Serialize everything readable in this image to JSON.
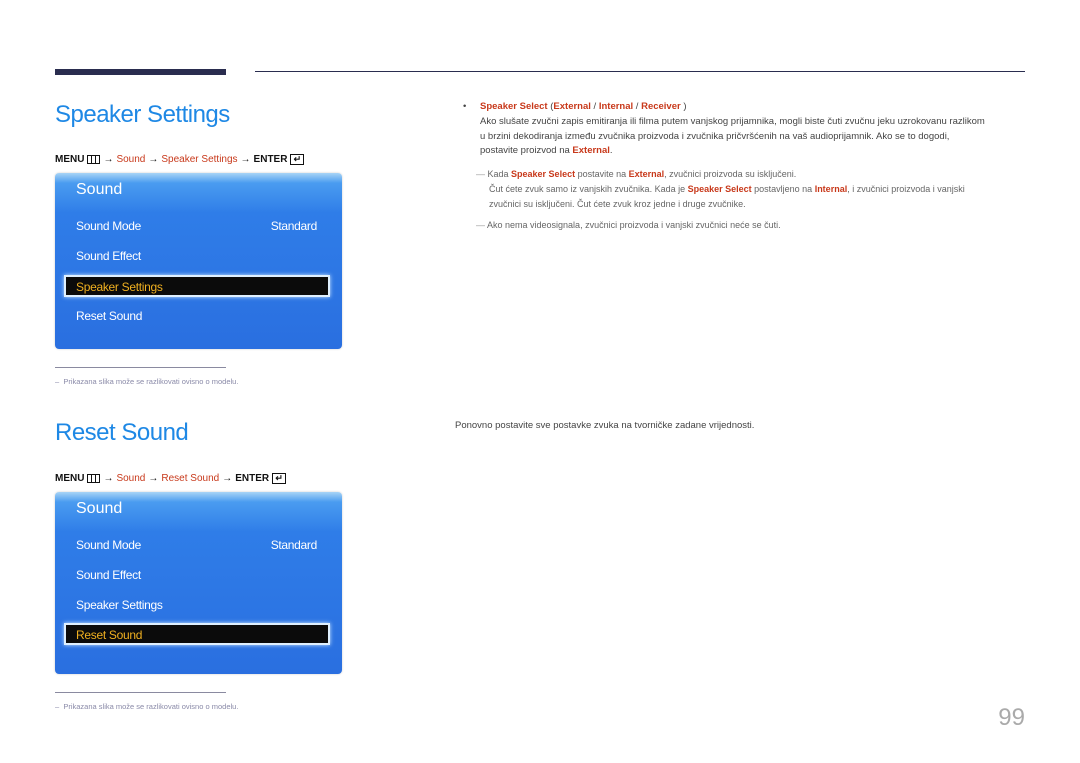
{
  "page_number": "99",
  "sections": [
    {
      "title": "Speaker Settings",
      "menu_path": {
        "menu": "MENU",
        "arrow": "→",
        "steps": [
          "Sound",
          "Speaker Settings"
        ],
        "enter": "ENTER",
        "enter_glyph": "↵"
      },
      "osd": {
        "title": "Sound",
        "items": [
          {
            "label": "Sound Mode",
            "value": "Standard"
          },
          {
            "label": "Sound Effect",
            "value": ""
          },
          {
            "label": "Speaker Settings",
            "value": "",
            "selected": true
          },
          {
            "label": "Reset Sound",
            "value": ""
          }
        ]
      },
      "footnote": "Prikazana slika može se razlikovati ovisno o modelu."
    },
    {
      "title": "Reset Sound",
      "menu_path": {
        "menu": "MENU",
        "arrow": "→",
        "steps": [
          "Sound",
          "Reset Sound"
        ],
        "enter": "ENTER",
        "enter_glyph": "↵"
      },
      "osd": {
        "title": "Sound",
        "items": [
          {
            "label": "Sound Mode",
            "value": "Standard"
          },
          {
            "label": "Sound Effect",
            "value": ""
          },
          {
            "label": "Speaker Settings",
            "value": ""
          },
          {
            "label": "Reset Sound",
            "value": "",
            "selected": true
          }
        ]
      },
      "footnote": "Prikazana slika može se razlikovati ovisno o modelu.",
      "description": "Ponovno postavite sve postavke zvuka na tvorničke zadane vrijednosti."
    }
  ],
  "speaker_select": {
    "bullet": "•",
    "name": "Speaker Select",
    "options_open": " (",
    "options": [
      "External",
      "Internal",
      "Receiver"
    ],
    "sep": " / ",
    "options_close": " )",
    "para_1": "Ako slušate zvučni zapis emitiranja ili filma putem vanjskog prijamnika, mogli biste čuti zvučnu jeku uzrokovanu razlikom",
    "para_2": "u brzini dekodiranja između zvučnika proizvoda i zvučnika pričvršćenih na vaš audioprijamnik. Ako se to dogodi,",
    "para_3_pre": "postavite proizvod na ",
    "para_3_kw": "External",
    "para_3_post": ".",
    "note_dash": "―",
    "note1_a": " Kada ",
    "note1_kw1": "Speaker Select",
    "note1_b": " postavite na ",
    "note1_kw2": "External",
    "note1_c": ", zvučnici proizvoda su isključeni.",
    "note1_d": "Čut ćete zvuk samo iz vanjskih zvučnika. Kada je ",
    "note1_kw3": "Speaker Select",
    "note1_e": " postavljeno na ",
    "note1_kw4": "Internal",
    "note1_f": ", i zvučnici proizvoda i vanjski",
    "note1_g": "zvučnici su isključeni. Čut ćete zvuk kroz jedne i druge zvučnike.",
    "note2": " Ako nema videosignala, zvučnici proizvoda i vanjski zvučnici neće se čuti."
  }
}
